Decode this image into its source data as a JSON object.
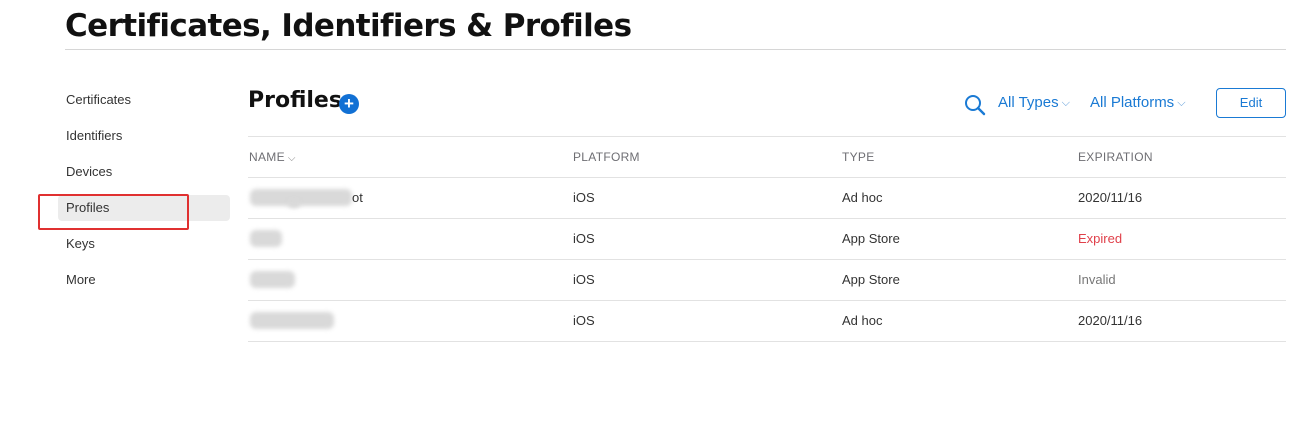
{
  "header": {
    "title": "Certificates, Identifiers & Profiles"
  },
  "sidebar": {
    "items": [
      {
        "label": "Certificates"
      },
      {
        "label": "Identifiers"
      },
      {
        "label": "Devices"
      },
      {
        "label": "Profiles",
        "active": true
      },
      {
        "label": "Keys"
      },
      {
        "label": "More"
      }
    ]
  },
  "main": {
    "title": "Profiles",
    "add_icon": "+",
    "toolbar": {
      "search_icon": "search-icon",
      "type_filter": "All Types",
      "platform_filter": "All Platforms",
      "chevron": "⌵",
      "edit_label": "Edit"
    },
    "table": {
      "columns": [
        "NAME",
        "PLATFORM",
        "TYPE",
        "EXPIRATION"
      ],
      "sort_indicator": "⌵",
      "rows": [
        {
          "name": "ot",
          "platform": "iOS",
          "type": "Ad hoc",
          "expiration": "2020/11/16",
          "status": "normal"
        },
        {
          "name": "",
          "platform": "iOS",
          "type": "App Store",
          "expiration": "Expired",
          "status": "expired"
        },
        {
          "name": "",
          "platform": "iOS",
          "type": "App Store",
          "expiration": "Invalid",
          "status": "invalid"
        },
        {
          "name": "",
          "platform": "iOS",
          "type": "Ad hoc",
          "expiration": "2020/11/16",
          "status": "normal"
        }
      ]
    }
  },
  "colors": {
    "accent": "#1a7ad4",
    "expired": "#e0404a",
    "highlight": "#e03030"
  }
}
